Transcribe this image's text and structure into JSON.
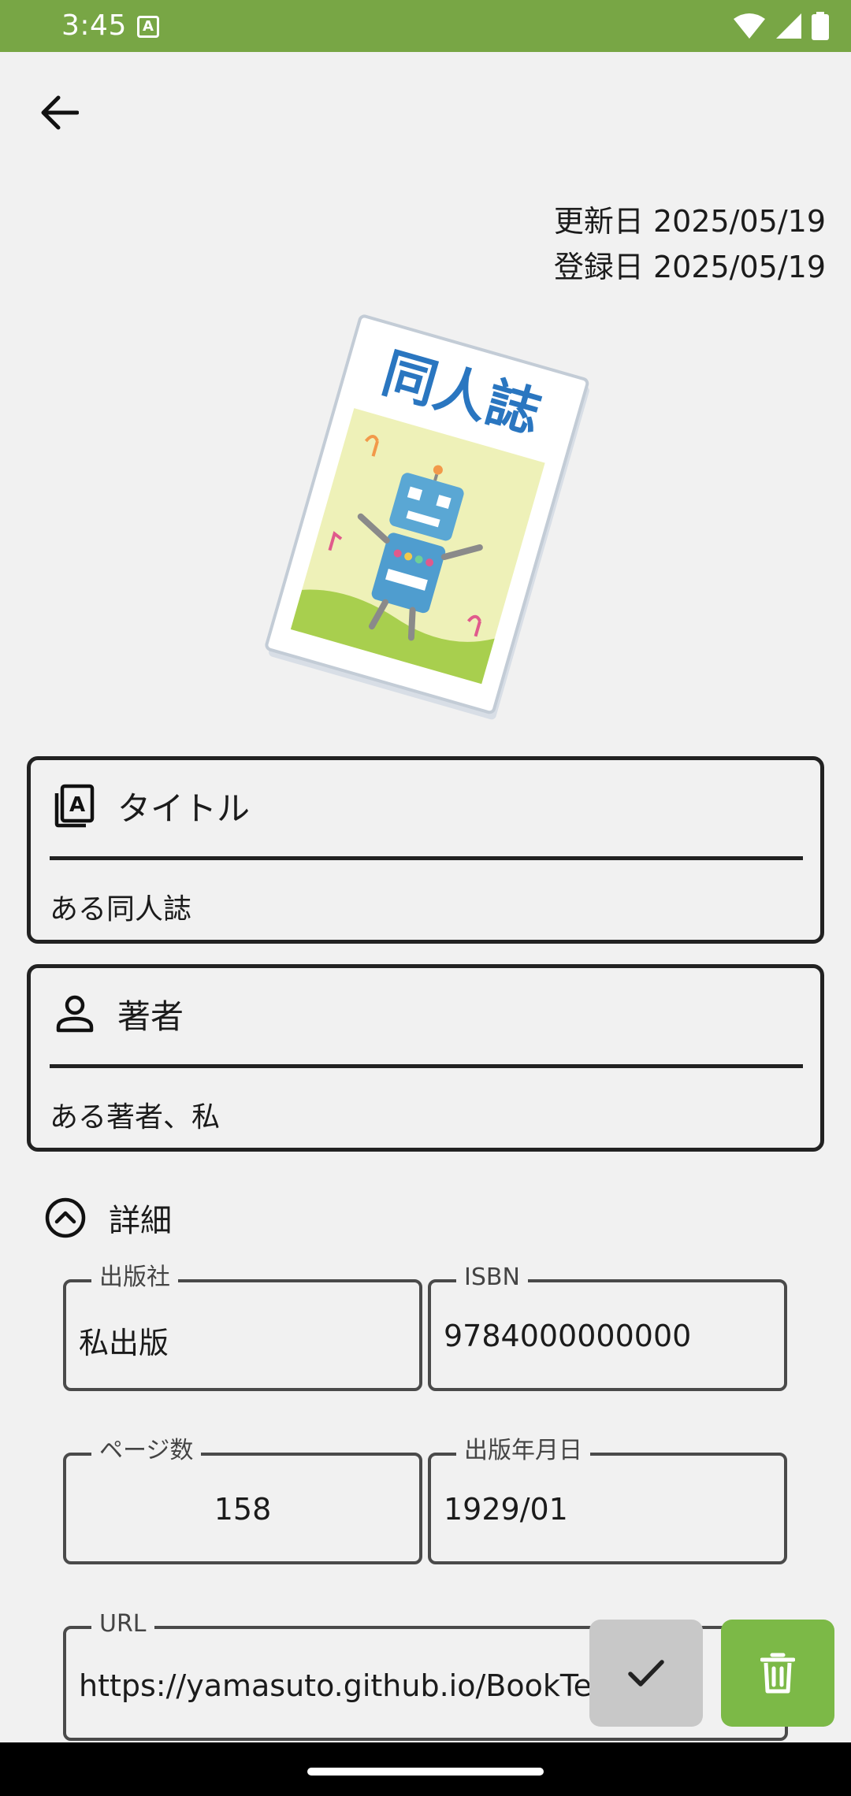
{
  "status_bar": {
    "time": "3:45",
    "notification_glyph": "A",
    "icons": [
      "wifi-icon",
      "signal-icon",
      "battery-icon"
    ]
  },
  "header": {
    "back_icon": "arrow-back-icon"
  },
  "dates": {
    "updated": "更新日 2025/05/19",
    "registered": "登録日 2025/05/19"
  },
  "cover": {
    "title_text": "同人誌"
  },
  "title_card": {
    "label": "タイトル",
    "value": "ある同人誌",
    "icon": "book-a-icon"
  },
  "author_card": {
    "label": "著者",
    "value": "ある著者、私",
    "icon": "person-icon"
  },
  "details": {
    "label": "詳細",
    "icon": "chevron-up-circle-icon"
  },
  "fields": {
    "publisher": {
      "label": "出版社",
      "value": "私出版"
    },
    "isbn": {
      "label": "ISBN",
      "value": "9784000000000"
    },
    "pages": {
      "label": "ページ数",
      "value": "158"
    },
    "pub_date": {
      "label": "出版年月日",
      "value": "1929/01"
    },
    "url": {
      "label": "URL",
      "value": "https://yamasuto.github.io/BookTech/Sub"
    }
  },
  "actions": {
    "confirm_icon": "check-icon",
    "delete_icon": "trash-icon"
  },
  "colors": {
    "status_bar": "#78a645",
    "delete_button": "#7cb947",
    "confirm_button": "#c8c8c8",
    "background": "#f1f1f1"
  }
}
